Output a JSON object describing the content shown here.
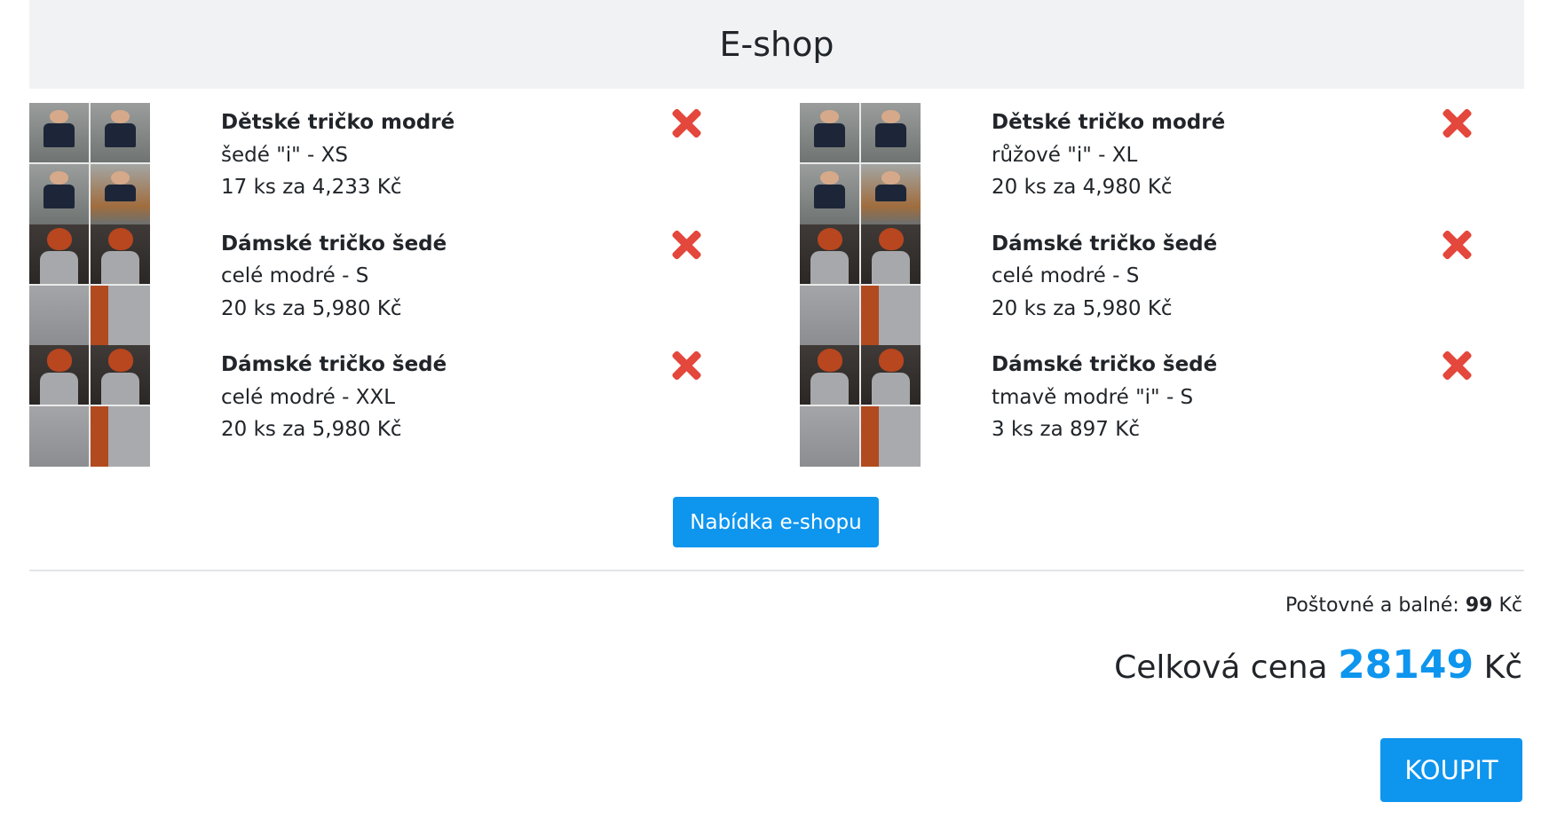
{
  "header": {
    "title": "E-shop"
  },
  "cart": {
    "left": [
      {
        "name": "Dětské tričko modré",
        "variant": "šedé \"i\" - XS",
        "quantity_price": "17 ks za 4,233 Kč"
      },
      {
        "name": "Dámské tričko šedé",
        "variant": "celé modré - S",
        "quantity_price": "20 ks za 5,980 Kč"
      },
      {
        "name": "Dámské tričko šedé",
        "variant": "celé modré - XXL",
        "quantity_price": "20 ks za 5,980 Kč"
      }
    ],
    "right": [
      {
        "name": "Dětské tričko modré",
        "variant": "růžové \"i\" - XL",
        "quantity_price": "20 ks za 4,980 Kč"
      },
      {
        "name": "Dámské tričko šedé",
        "variant": "celé modré - S",
        "quantity_price": "20 ks za 5,980 Kč"
      },
      {
        "name": "Dámské tričko šedé",
        "variant": "tmavě modré \"i\" - S",
        "quantity_price": "3 ks za 897 Kč"
      }
    ],
    "remove_icon": "close-x-icon",
    "remove_color": "#e4473c"
  },
  "offer_button": {
    "label": "Nabídka e-shopu"
  },
  "summary": {
    "shipping_label": "Poštovné a balné:",
    "shipping_value": "99",
    "shipping_currency": "Kč",
    "total_label": "Celková cena",
    "total_value": "28149",
    "total_currency": "Kč"
  },
  "buy_button": {
    "label": "KOUPIT"
  },
  "colors": {
    "accent": "#0e95ee",
    "header_bg": "#f1f2f4",
    "text": "#212529"
  }
}
